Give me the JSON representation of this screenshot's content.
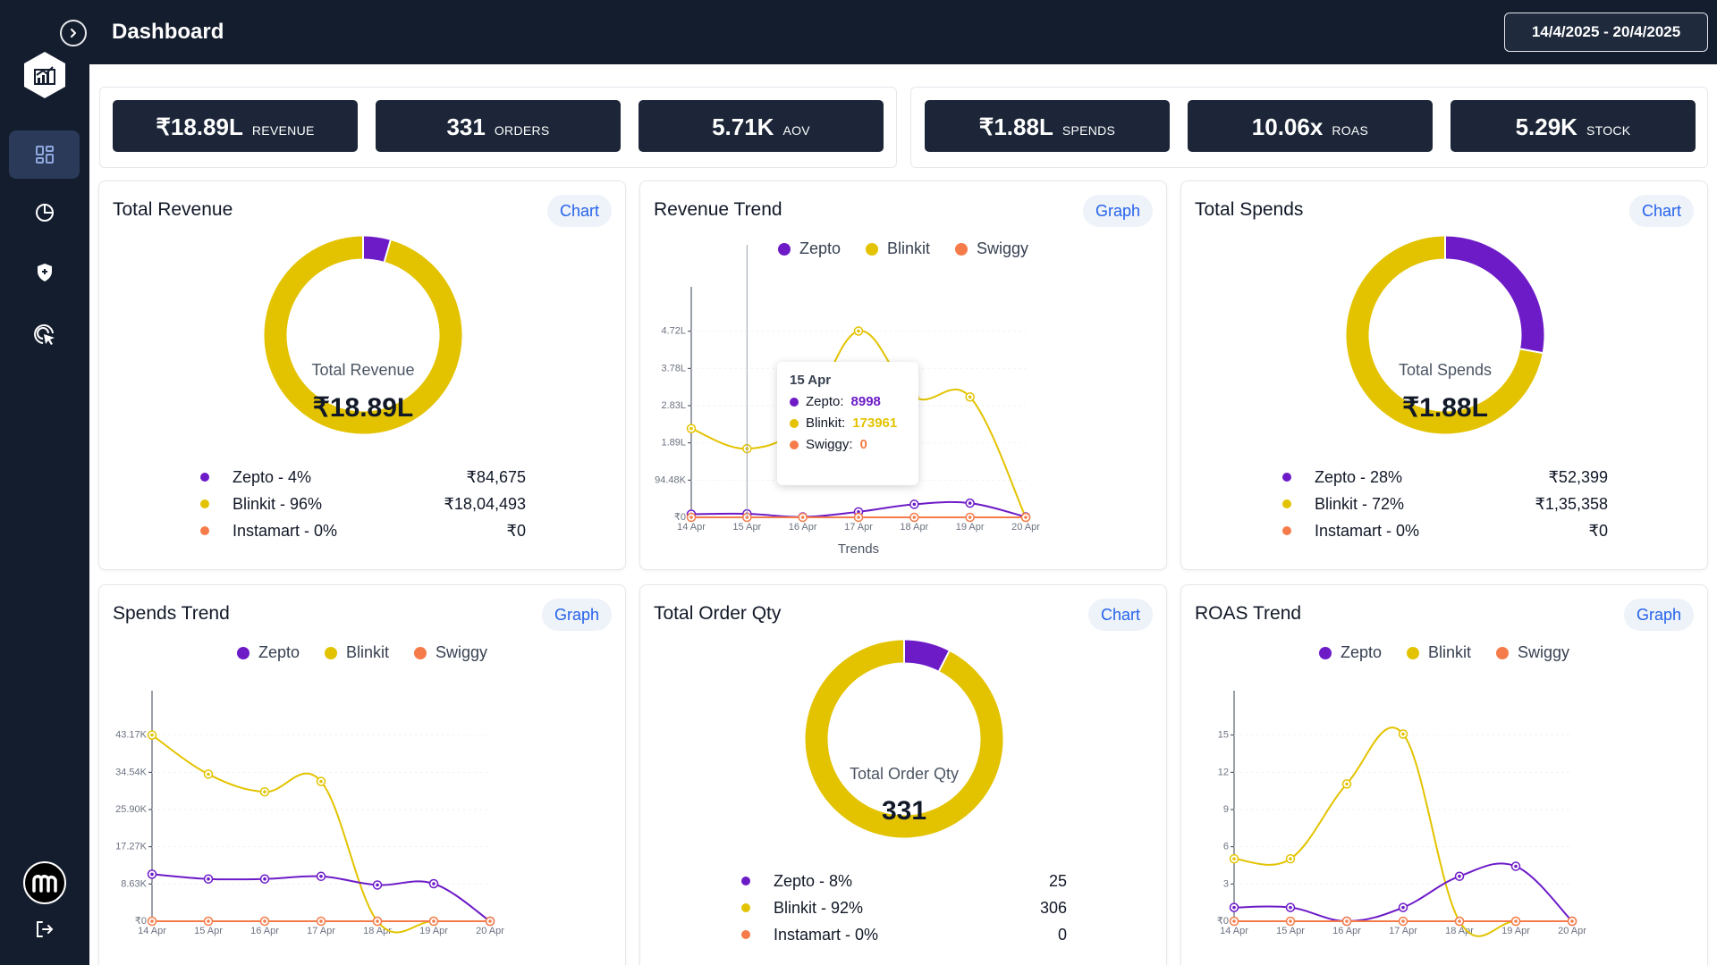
{
  "header": {
    "title": "Dashboard",
    "date_range": "14/4/2025 - 20/4/2025"
  },
  "sidebar": {
    "items": [
      {
        "icon": "dashboard-icon",
        "active": true
      },
      {
        "icon": "pie-chart-icon",
        "active": false
      },
      {
        "icon": "shield-icon",
        "active": false
      },
      {
        "icon": "target-cursor-icon",
        "active": false
      }
    ],
    "avatar_letter": "m"
  },
  "kpis_left": [
    {
      "value": "₹18.89L",
      "label": "REVENUE"
    },
    {
      "value": "331",
      "label": "ORDERS"
    },
    {
      "value": "5.71K",
      "label": "AOV"
    }
  ],
  "kpis_right": [
    {
      "value": "₹1.88L",
      "label": "SPENDS"
    },
    {
      "value": "10.06x",
      "label": "ROAS"
    },
    {
      "value": "5.29K",
      "label": "STOCK"
    }
  ],
  "colors": {
    "zepto": "#6d1bc7",
    "blinkit": "#e3c300",
    "swiggy": "#f57c4a",
    "instamart": "#f57c4a",
    "navy": "#141d2e",
    "accent": "#2563eb"
  },
  "total_revenue": {
    "title": "Total Revenue",
    "button": "Chart",
    "center_label": "Total Revenue",
    "center_value": "₹18.89L",
    "segments": [
      {
        "name": "Zepto - 4%",
        "value": "₹84,675",
        "share": 4.48
      },
      {
        "name": "Blinkit - 96%",
        "value": "₹18,04,493",
        "share": 95.52
      },
      {
        "name": "Instamart - 0%",
        "value": "₹0",
        "share": 0
      }
    ]
  },
  "revenue_trend": {
    "title": "Revenue Trend",
    "button": "Graph",
    "legend": [
      "Zepto",
      "Blinkit",
      "Swiggy"
    ],
    "tooltip": {
      "date": "15 Apr",
      "rows": [
        {
          "name": "Zepto:",
          "value": "8998"
        },
        {
          "name": "Blinkit:",
          "value": "173961"
        },
        {
          "name": "Swiggy:",
          "value": "0"
        }
      ]
    }
  },
  "total_spends": {
    "title": "Total Spends",
    "button": "Chart",
    "center_label": "Total Spends",
    "center_value": "₹1.88L",
    "segments": [
      {
        "name": "Zepto - 28%",
        "value": "₹52,399",
        "share": 27.9
      },
      {
        "name": "Blinkit - 72%",
        "value": "₹1,35,358",
        "share": 72.1
      },
      {
        "name": "Instamart - 0%",
        "value": "₹0",
        "share": 0
      }
    ]
  },
  "spends_trend": {
    "title": "Spends Trend",
    "button": "Graph",
    "legend": [
      "Zepto",
      "Blinkit",
      "Swiggy"
    ]
  },
  "total_order_qty": {
    "title": "Total Order Qty",
    "button": "Chart",
    "center_label": "Total Order Qty",
    "center_value": "331",
    "segments": [
      {
        "name": "Zepto - 8%",
        "value": "25",
        "share": 7.55
      },
      {
        "name": "Blinkit - 92%",
        "value": "306",
        "share": 92.45
      },
      {
        "name": "Instamart - 0%",
        "value": "0",
        "share": 0
      }
    ]
  },
  "roas_trend": {
    "title": "ROAS Trend",
    "button": "Graph",
    "legend": [
      "Zepto",
      "Blinkit",
      "Swiggy"
    ]
  },
  "chart_data": [
    {
      "type": "line",
      "xlabel": "Trends",
      "categories": [
        "14 Apr",
        "15 Apr",
        "16 Apr",
        "17 Apr",
        "18 Apr",
        "19 Apr",
        "20 Apr"
      ],
      "ytick_labels": [
        "₹0",
        "94.48K",
        "1.89L",
        "2.83L",
        "3.78L",
        "4.72L"
      ],
      "ylim": [
        0,
        566000
      ],
      "series": [
        {
          "name": "Zepto",
          "values": [
            8000,
            8998,
            1000,
            14000,
            33000,
            36000,
            1000
          ]
        },
        {
          "name": "Blinkit",
          "values": [
            225000,
            173961,
            240000,
            472000,
            305000,
            305000,
            0
          ]
        },
        {
          "name": "Swiggy",
          "values": [
            0,
            0,
            0,
            0,
            0,
            0,
            0
          ]
        }
      ]
    },
    {
      "type": "line",
      "categories": [
        "14 Apr",
        "15 Apr",
        "16 Apr",
        "17 Apr",
        "18 Apr",
        "19 Apr",
        "20 Apr"
      ],
      "ytick_labels": [
        "₹0",
        "8.63K",
        "17.27K",
        "25.90K",
        "34.54K",
        "43.17K"
      ],
      "ylim": [
        0,
        51800
      ],
      "series": [
        {
          "name": "Zepto",
          "values": [
            10900,
            9800,
            9800,
            10400,
            8400,
            8700,
            0
          ]
        },
        {
          "name": "Blinkit",
          "values": [
            43170,
            34100,
            30000,
            32400,
            0,
            0,
            0
          ]
        },
        {
          "name": "Swiggy",
          "values": [
            0,
            0,
            0,
            0,
            0,
            0,
            0
          ]
        }
      ]
    },
    {
      "type": "line",
      "categories": [
        "14 Apr",
        "15 Apr",
        "16 Apr",
        "17 Apr",
        "18 Apr",
        "19 Apr",
        "20 Apr"
      ],
      "ytick_labels": [
        "₹0",
        "3",
        "6",
        "9",
        "12",
        "15"
      ],
      "ylim": [
        0,
        17.9
      ],
      "series": [
        {
          "name": "Zepto",
          "values": [
            1.1,
            1.1,
            0,
            1.1,
            3.6,
            4.4,
            0
          ]
        },
        {
          "name": "Blinkit",
          "values": [
            5,
            5,
            11,
            15,
            0,
            0,
            0
          ]
        },
        {
          "name": "Swiggy",
          "values": [
            0,
            0,
            0,
            0,
            0,
            0,
            0
          ]
        }
      ]
    }
  ]
}
